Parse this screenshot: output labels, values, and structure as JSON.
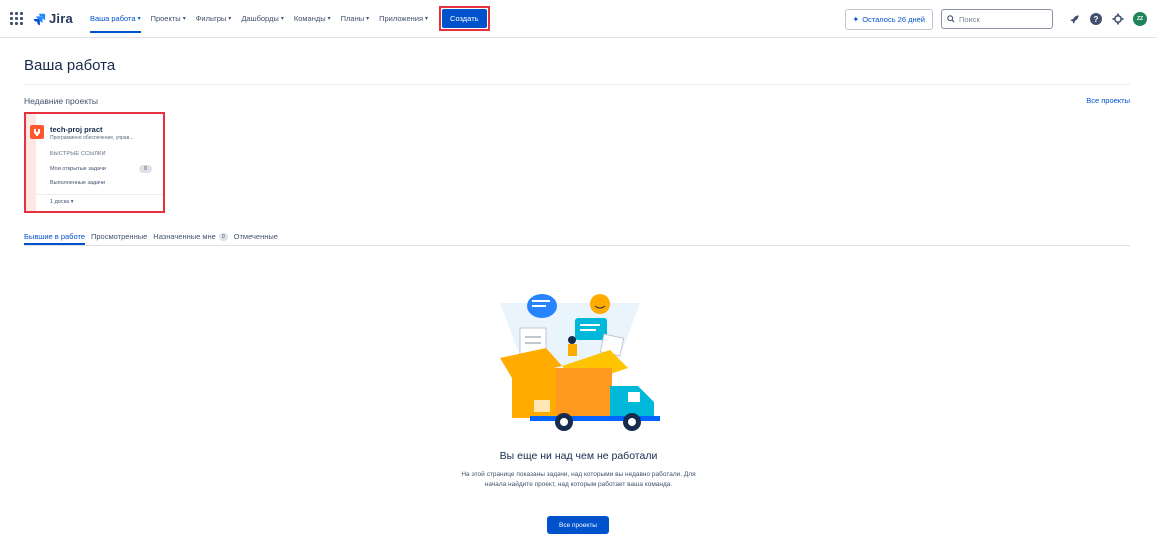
{
  "app": {
    "product": "Jira"
  },
  "nav": {
    "items": [
      {
        "label": "Ваша работа"
      },
      {
        "label": "Проекты"
      },
      {
        "label": "Фильтры"
      },
      {
        "label": "Дашборды"
      },
      {
        "label": "Команды"
      },
      {
        "label": "Планы"
      },
      {
        "label": "Приложения"
      }
    ],
    "create_label": "Создать"
  },
  "topbar": {
    "trial_label": "Осталось 26 дней",
    "search_placeholder": "Поиск",
    "avatar_initials": "ZZ"
  },
  "page": {
    "title": "Ваша работа",
    "recent_label": "Недавние проекты",
    "all_projects_link": "Все проекты"
  },
  "project": {
    "name": "tech-proj pract",
    "description": "Программное обеспечение, управ...",
    "quick_links_label": "БЫСТРЫЕ ССЫЛКИ",
    "open_tasks_label": "Мои открытые задачи",
    "open_tasks_count": "0",
    "done_tasks_label": "Выполненные задачи",
    "boards_label": "1 доска"
  },
  "tabs": [
    {
      "label": "Бывшие в работе"
    },
    {
      "label": "Просмотренные"
    },
    {
      "label": "Назначенные мне",
      "badge": "0"
    },
    {
      "label": "Отмеченные"
    }
  ],
  "empty_state": {
    "title": "Вы еще ни над чем не работали",
    "text": "На этой странице показаны задачи, над которыми вы недавно работали. Для начала найдите проект, над которым работает ваша команда.",
    "button_label": "Все проекты"
  },
  "colors": {
    "primary": "#0052cc",
    "highlight": "#e5323e",
    "avatar": "#1f845a",
    "project_icon": "#ff5630"
  }
}
